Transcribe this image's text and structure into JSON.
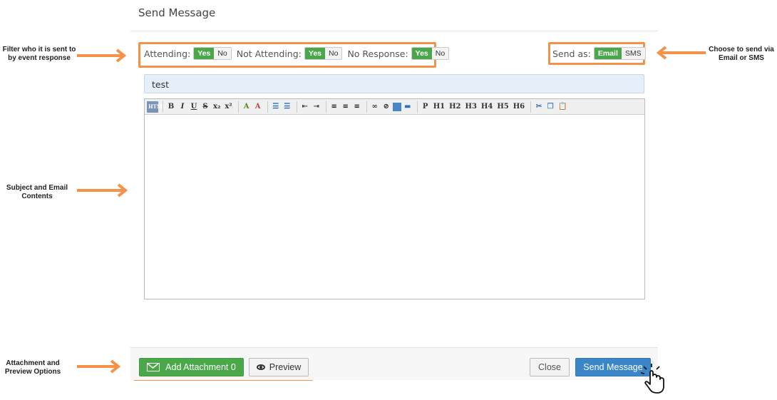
{
  "modal": {
    "title": "Send Message"
  },
  "filters": {
    "attending": {
      "label": "Attending:",
      "yes": "Yes",
      "no": "No"
    },
    "not_attending": {
      "label": "Not Attending:",
      "yes": "Yes",
      "no": "No"
    },
    "no_response": {
      "label": "No Response:",
      "yes": "Yes",
      "no": "No"
    }
  },
  "send_as": {
    "label": "Send as:",
    "email": "Email",
    "sms": "SMS",
    "selected": "Email"
  },
  "subject": {
    "value": "test"
  },
  "editor": {
    "toolbar": {
      "html": "HTML",
      "bold": "B",
      "italic": "I",
      "underline": "U",
      "strike": "S",
      "subscript": "x₂",
      "superscript": "x²",
      "font_color": "A",
      "bg_color": "A",
      "ordered_list": "☰",
      "unordered_list": "☰",
      "outdent": "⇤",
      "indent": "⇥",
      "align_left": "≡",
      "align_center": "≡",
      "align_right": "≡",
      "link": "∞",
      "unlink": "⊘",
      "hr": "▬",
      "p": "P",
      "h1": "H1",
      "h2": "H2",
      "h3": "H3",
      "h4": "H4",
      "h5": "H5",
      "h6": "H6",
      "cut": "✂",
      "copy": "❐",
      "paste": "📋"
    },
    "body": ""
  },
  "footer": {
    "add_attachment": "Add Attachment 0",
    "preview": "Preview",
    "close": "Close",
    "send": "Send Message"
  },
  "callouts": {
    "filter": "Filter who it is sent to\nby event response",
    "send_via": "Choose to send via\nEmail or SMS",
    "subject": "Subject and Email\nContents",
    "attachment": "Attachment and\nPreview Options"
  },
  "colors": {
    "highlight": "#f5924a",
    "toggle_on": "#4aa84a",
    "send_button": "#3a86c8",
    "subject_bg": "#e6eefa"
  }
}
